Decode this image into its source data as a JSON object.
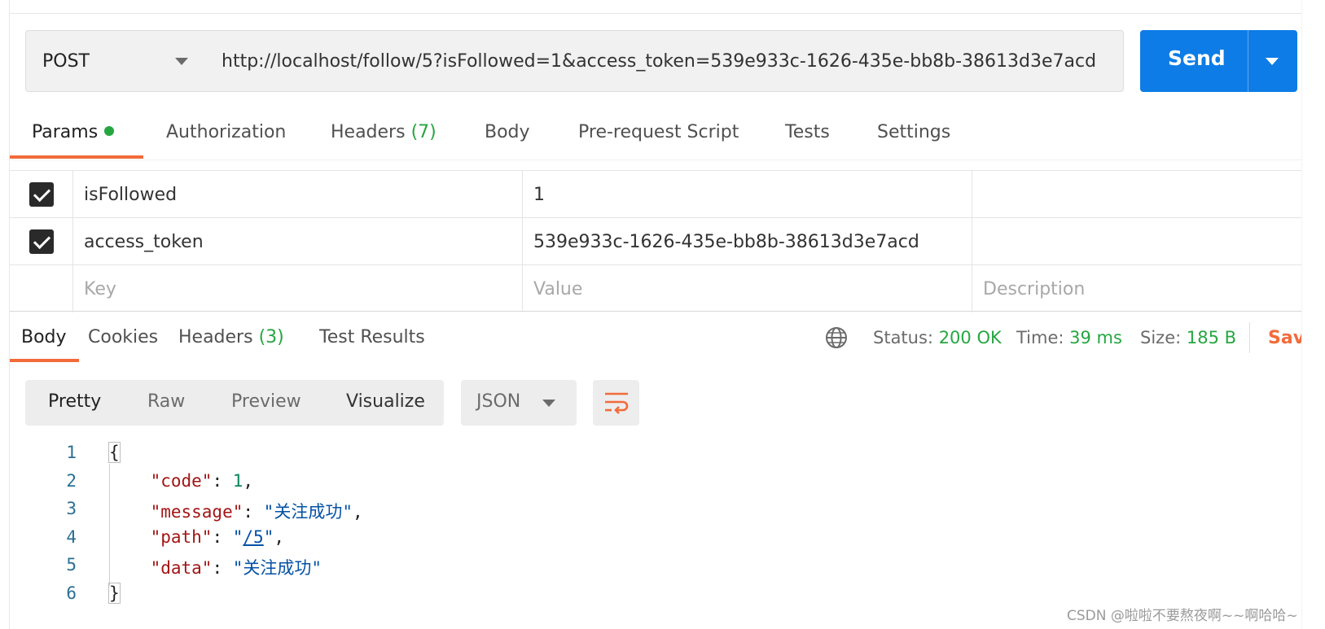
{
  "request": {
    "method": "POST",
    "url": "http://localhost/follow/5?isFollowed=1&access_token=539e933c-1626-435e-bb8b-38613d3e7acd",
    "send_label": "Send"
  },
  "request_tabs": [
    {
      "label": "Params",
      "count": "",
      "active": true,
      "has_dot": true
    },
    {
      "label": "Authorization",
      "count": ""
    },
    {
      "label": "Headers",
      "count": "(7)"
    },
    {
      "label": "Body",
      "count": ""
    },
    {
      "label": "Pre-request Script",
      "count": ""
    },
    {
      "label": "Tests",
      "count": ""
    },
    {
      "label": "Settings",
      "count": ""
    }
  ],
  "params": {
    "rows": [
      {
        "checked": true,
        "key": "isFollowed",
        "value": "1",
        "description": ""
      },
      {
        "checked": true,
        "key": "access_token",
        "value": "539e933c-1626-435e-bb8b-38613d3e7acd",
        "description": ""
      }
    ],
    "placeholders": {
      "key": "Key",
      "value": "Value",
      "description": "Description"
    }
  },
  "response_tabs": [
    {
      "label": "Body",
      "count": "",
      "active": true
    },
    {
      "label": "Cookies",
      "count": ""
    },
    {
      "label": "Headers",
      "count": "(3)"
    },
    {
      "label": "Test Results",
      "count": ""
    }
  ],
  "response_status": {
    "status_label": "Status:",
    "status_value": "200 OK",
    "time_label": "Time:",
    "time_value": "39 ms",
    "size_label": "Size:",
    "size_value": "185 B",
    "save_label": "Save Response"
  },
  "format_tabs": [
    "Pretty",
    "Raw",
    "Preview",
    "Visualize"
  ],
  "language": "JSON",
  "code": {
    "line_numbers": [
      "1",
      "2",
      "3",
      "4",
      "5",
      "6"
    ],
    "open_brace": "{",
    "close_brace": "}",
    "fields": [
      {
        "key": "\"code\"",
        "value": "1",
        "type": "number",
        "comma": ","
      },
      {
        "key": "\"message\"",
        "value": "\"关注成功\"",
        "type": "string",
        "comma": ","
      },
      {
        "key": "\"path\"",
        "value_open": "\"",
        "value_link": "/5",
        "value_close": "\"",
        "type": "link",
        "comma": ","
      },
      {
        "key": "\"data\"",
        "value": "\"关注成功\"",
        "type": "string",
        "comma": ""
      }
    ]
  },
  "watermark": "CSDN @啦啦不要熬夜啊~~啊哈哈~",
  "icons": [
    "chevron-down-icon",
    "globe-icon",
    "wrap-lines-icon",
    "checkbox-checked-icon"
  ],
  "colors": {
    "accent_blue": "#0d7ce6",
    "accent_orange": "#f26b3a",
    "success_green": "#26a641"
  }
}
